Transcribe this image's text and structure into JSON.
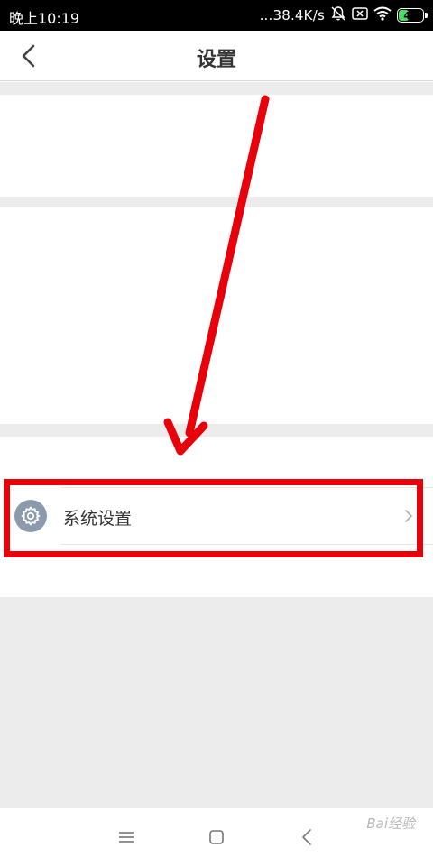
{
  "status_bar": {
    "time": "晚上10:19",
    "net_speed": "...38.4K/s",
    "battery_level": "43",
    "battery_percent": 43
  },
  "header": {
    "title": "设置"
  },
  "settings": {
    "system_settings_label": "系统设置"
  },
  "watermark": {
    "text": "Bai经验"
  },
  "icons": {
    "back": "chevron-left-icon",
    "mute": "bell-off-icon",
    "sim": "sim-x-icon",
    "wifi": "wifi-icon",
    "battery": "battery-icon",
    "system_settings": "gear-icon",
    "row_chevron": "chevron-right-icon",
    "nav_menu": "menu-icon",
    "nav_home": "square-home-icon",
    "nav_back": "triangle-back-icon"
  },
  "colors": {
    "annotation_red": "#e8000b",
    "battery_green": "#4cd964",
    "gear_icon_bg": "#8c9bab",
    "section_gap": "#ececec"
  }
}
